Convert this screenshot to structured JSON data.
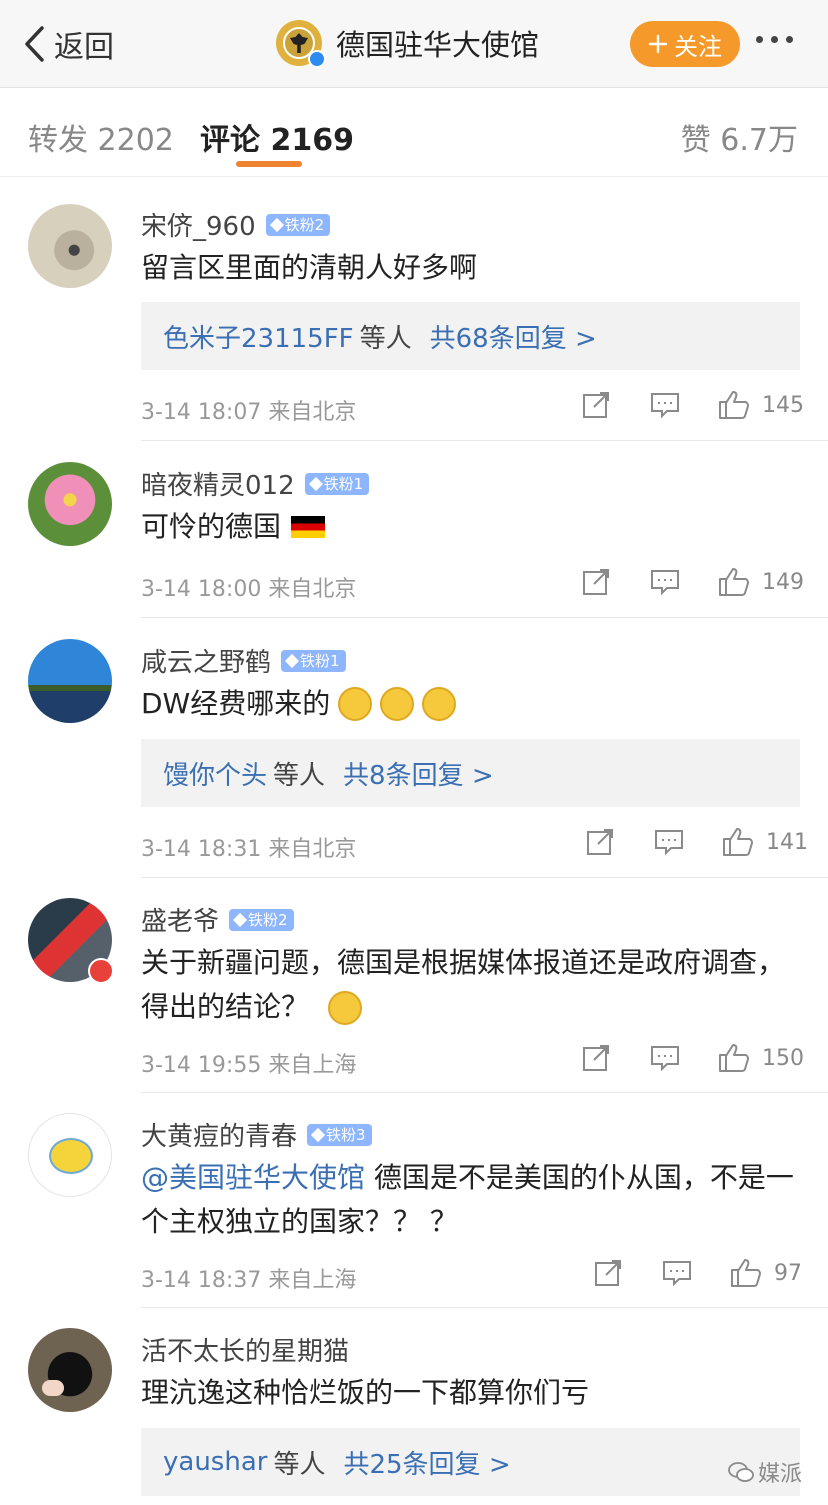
{
  "nav": {
    "back_label": "返回",
    "account_name": "德国驻华大使馆",
    "follow_label": "关注"
  },
  "tabs": {
    "repost": "转发 2202",
    "comments": "评论 2169",
    "likes": "赞 6.7万"
  },
  "comments": [
    {
      "user": "宋侪_960",
      "badge": "铁粉2",
      "text": "留言区里面的清朝人好多啊",
      "replies": {
        "who": "色米子23115FF",
        "etc": "等人",
        "count": "共68条回复 >"
      },
      "time": "3-14 18:07",
      "location": "来自北京",
      "likes": "145"
    },
    {
      "user": "暗夜精灵012",
      "badge": "铁粉1",
      "text": "可怜的德国",
      "time": "3-14 18:00",
      "location": "来自北京",
      "likes": "149"
    },
    {
      "user": "咸云之野鹤",
      "badge": "铁粉1",
      "text": "DW经费哪来的",
      "replies": {
        "who": "馒你个头",
        "etc": "等人",
        "count": "共8条回复 >"
      },
      "time": "3-14 18:31",
      "location": "来自北京",
      "likes": "141"
    },
    {
      "user": "盛老爷",
      "badge": "铁粉2",
      "text": "关于新疆问题，德国是根据媒体报道还是政府调查，得出的结论？",
      "time": "3-14 19:55",
      "location": "来自上海",
      "likes": "150"
    },
    {
      "user": "大黄痘的青春",
      "badge": "铁粉3",
      "mention": "@美国驻华大使馆",
      "text": "德国是不是美国的仆从国，不是一个主权独立的国家？？ ？",
      "time": "3-14 18:37",
      "location": "来自上海",
      "likes": "97"
    },
    {
      "user": "活不太长的星期猫",
      "text": "理沆逸这种恰烂饭的一下都算你们亏",
      "replies": {
        "who": "yaushar",
        "etc": "等人",
        "count": "共25条回复 >"
      }
    }
  ],
  "watermark": "媒派",
  "colors": {
    "accent": "#f08332",
    "link": "#3b6fb4",
    "badge": "#8eb6ff",
    "follow": "#f59a2a"
  }
}
